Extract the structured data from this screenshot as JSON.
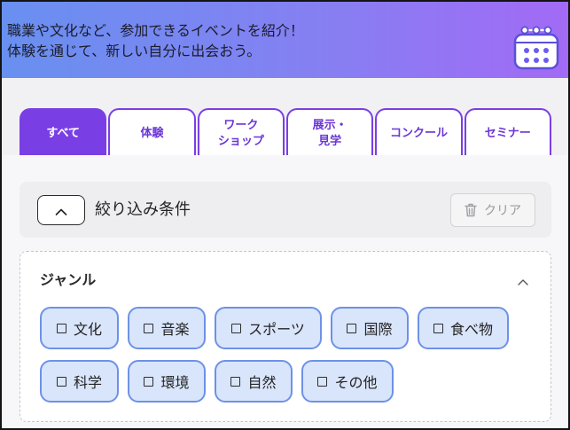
{
  "colors": {
    "accent": "#7a3fe4",
    "accent_text": "#6b36d6",
    "banner_start": "#6890f0",
    "banner_end": "#a26af5",
    "chip_bg": "#d9e5fb",
    "chip_border": "#6d92e6"
  },
  "banner": {
    "line1": "職業や文化など、参加できるイベントを紹介！",
    "line2": "体験を通じて、新しい自分に出会おう。",
    "icon": "calendar-icon"
  },
  "tabs": [
    {
      "lines": [
        "すべて"
      ],
      "selected": true
    },
    {
      "lines": [
        "体験"
      ],
      "selected": false
    },
    {
      "lines": [
        "ワーク",
        "ショップ"
      ],
      "selected": false
    },
    {
      "lines": [
        "展示・",
        "見学"
      ],
      "selected": false
    },
    {
      "lines": [
        "コンクール"
      ],
      "selected": false
    },
    {
      "lines": [
        "セミナー"
      ],
      "selected": false
    }
  ],
  "filter": {
    "title": "絞り込み条件",
    "toggle_icon": "chevron-up-icon",
    "clear_label": "クリア",
    "clear_icon": "trash-icon"
  },
  "genre": {
    "title": "ジャンル",
    "toggle_icon": "chevron-up-icon",
    "checkbox_icon": "checkbox-icon",
    "options": [
      {
        "label": "文化",
        "checked": false
      },
      {
        "label": "音楽",
        "checked": false
      },
      {
        "label": "スポーツ",
        "checked": false
      },
      {
        "label": "国際",
        "checked": false
      },
      {
        "label": "食べ物",
        "checked": false
      },
      {
        "label": "科学",
        "checked": false
      },
      {
        "label": "環境",
        "checked": false
      },
      {
        "label": "自然",
        "checked": false
      },
      {
        "label": "その他",
        "checked": false
      }
    ]
  }
}
